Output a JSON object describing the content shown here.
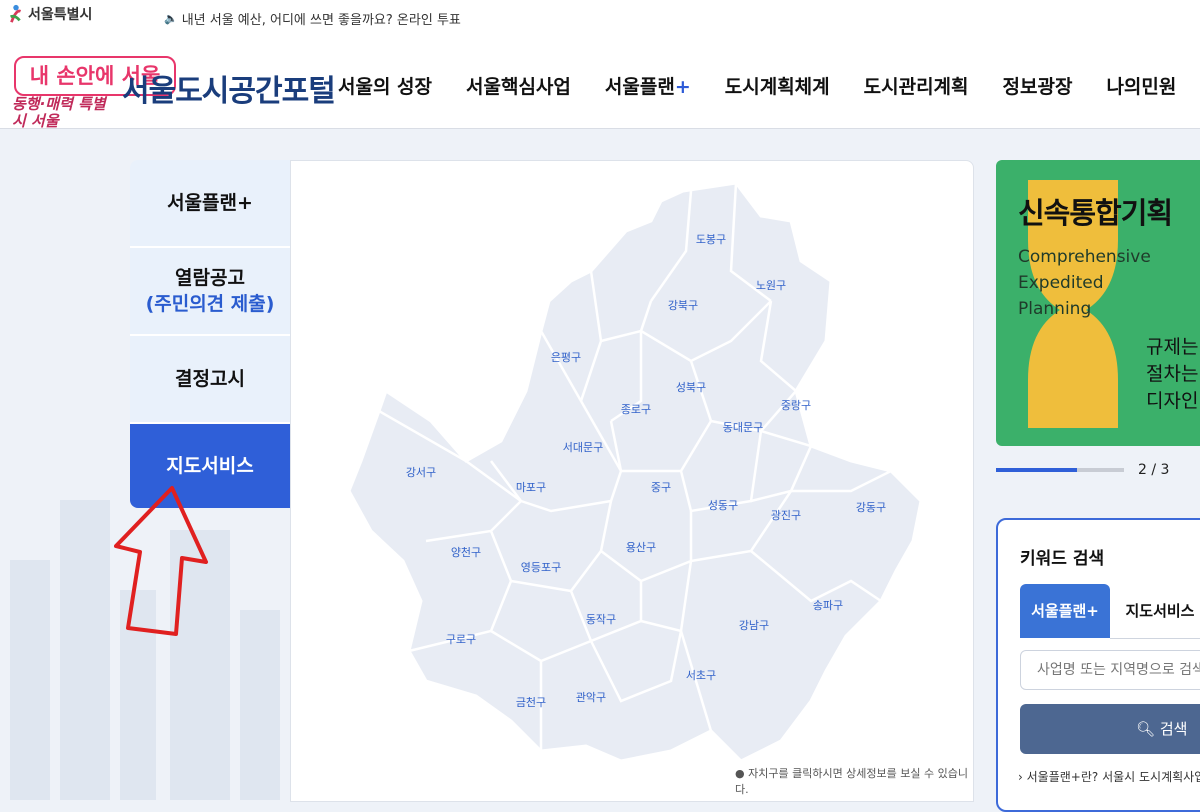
{
  "topbar": {
    "city_name": "서울특별시",
    "notice": "내년 서울 예산, 어디에 쓰면 좋을까요? 온라인 투표"
  },
  "header": {
    "slogan_badge": "내 손안에 서울",
    "slogan_script": "동행·매력 특별시 서울",
    "portal_title": "서울도시공간포털",
    "nav": [
      {
        "label": "서울의 성장"
      },
      {
        "label": "서울핵심사업"
      },
      {
        "label": "서울플랜",
        "suffix": "+"
      },
      {
        "label": "도시계획체계"
      },
      {
        "label": "도시관리계획"
      },
      {
        "label": "정보광장"
      },
      {
        "label": "나의민원"
      }
    ]
  },
  "side_tabs": [
    {
      "label": "서울플랜+"
    },
    {
      "label": "열람공고",
      "sub": "(주민의견 제출)"
    },
    {
      "label": "결정고시"
    },
    {
      "label": "지도서비스",
      "active": true
    }
  ],
  "map": {
    "districts": [
      "도봉구",
      "노원구",
      "강북구",
      "은평구",
      "성북구",
      "종로구",
      "중랑구",
      "동대문구",
      "서대문구",
      "강서구",
      "마포구",
      "중구",
      "성동구",
      "광진구",
      "강동구",
      "양천구",
      "용산구",
      "영등포구",
      "송파구",
      "동작구",
      "강남구",
      "구로구",
      "서초구",
      "금천구",
      "관악구"
    ],
    "note": "자치구를 클릭하시면 상세정보를 보실 수 있습니다."
  },
  "promo": {
    "title": "신속통합기획",
    "english": "Comprehensive Expedited Planning",
    "desc_lines": [
      "규제는",
      "절차는",
      "디자인"
    ],
    "pager": "2 / 3",
    "pager_progress": 0.63
  },
  "search": {
    "heading": "키워드 검색",
    "tab_active": "서울플랜+",
    "tab_inactive": "지도서비스",
    "placeholder": "사업명 또는 지역명으로 검색해",
    "button": "검색",
    "footer": "서울플랜+란? 서울시 도시계획사업 통합"
  },
  "colors": {
    "brand_blue": "#2f5fd8",
    "title_navy": "#1a3d7c",
    "promo_green": "#3bb06a",
    "slogan_pink": "#e8366b",
    "annotation_red": "#e02020"
  },
  "icons": [
    "seoul-emblem-icon",
    "speaker-icon",
    "search-icon",
    "tab-pointer-icon",
    "annotation-arrow-icon"
  ]
}
